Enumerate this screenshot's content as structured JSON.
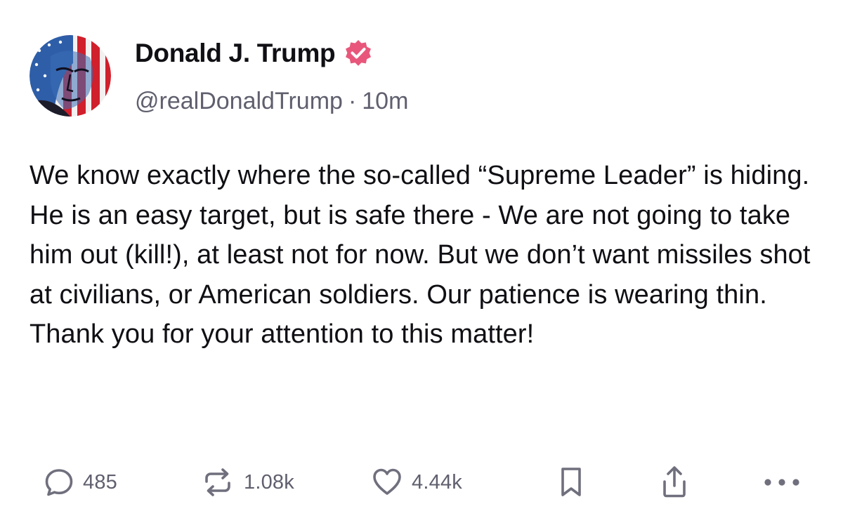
{
  "post": {
    "author": {
      "display_name": "Donald J. Trump",
      "handle": "@realDonaldTrump",
      "verified_icon": "verified-badge-icon",
      "verified_color": "#e8577b"
    },
    "separator": "·",
    "time_ago": "10m",
    "text": "We know exactly where the so-called “Supreme Leader” is hiding. He is an easy target, but is safe there - We are not going to take him out (kill!), at least not for now. But we don’t want missiles shot at civilians, or American soldiers. Our patience is wearing thin. Thank you for your attention to this matter!",
    "actions": {
      "replies": "485",
      "reposts": "1.08k",
      "likes": "4.44k"
    }
  },
  "icons": {
    "reply": "speech-bubble-icon",
    "repost": "repost-arrows-icon",
    "like": "heart-icon",
    "bookmark": "bookmark-icon",
    "share": "share-upload-icon",
    "more": "more-dots-icon"
  },
  "colors": {
    "text": "#0f0f14",
    "secondary": "#5f5f6e",
    "icon": "#6f6f7d",
    "background": "#ffffff"
  }
}
